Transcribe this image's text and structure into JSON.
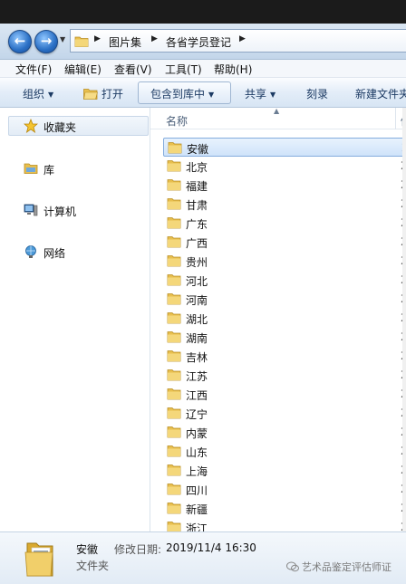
{
  "address": {
    "crumbs": [
      "图片集",
      "各省学员登记"
    ]
  },
  "menu": [
    "文件(F)",
    "编辑(E)",
    "查看(V)",
    "工具(T)",
    "帮助(H)"
  ],
  "toolbar": {
    "organize": "组织",
    "open": "打开",
    "include": "包含到库中",
    "share": "共享",
    "burn": "刻录",
    "newfolder": "新建文件夹"
  },
  "nav": {
    "favorites": "收藏夹",
    "libraries": "库",
    "computer": "计算机",
    "network": "网络"
  },
  "list": {
    "header_name": "名称",
    "header_date": "修",
    "items": [
      {
        "name": "安徽",
        "date": "2"
      },
      {
        "name": "北京",
        "date": "2"
      },
      {
        "name": "福建",
        "date": "2"
      },
      {
        "name": "甘肃",
        "date": "2"
      },
      {
        "name": "广东",
        "date": "2"
      },
      {
        "name": "广西",
        "date": "2"
      },
      {
        "name": "贵州",
        "date": "2"
      },
      {
        "name": "河北",
        "date": "2"
      },
      {
        "name": "河南",
        "date": "2"
      },
      {
        "name": "湖北",
        "date": "2"
      },
      {
        "name": "湖南",
        "date": "2"
      },
      {
        "name": "吉林",
        "date": "2"
      },
      {
        "name": "江苏",
        "date": "2"
      },
      {
        "name": "江西",
        "date": "2"
      },
      {
        "name": "辽宁",
        "date": "2"
      },
      {
        "name": "内蒙",
        "date": "2"
      },
      {
        "name": "山东",
        "date": "2"
      },
      {
        "name": "上海",
        "date": "2"
      },
      {
        "name": "四川",
        "date": "2"
      },
      {
        "name": "新疆",
        "date": "2"
      },
      {
        "name": "浙江",
        "date": "2"
      }
    ]
  },
  "details": {
    "name": "安徽",
    "type": "文件夹",
    "date_label": "修改日期:",
    "date_value": "2019/11/4 16:30",
    "watermark": "艺术品鉴定评估师证"
  },
  "colors": {
    "selection": "#cfe3fa",
    "folder": "#e8bf4e"
  }
}
